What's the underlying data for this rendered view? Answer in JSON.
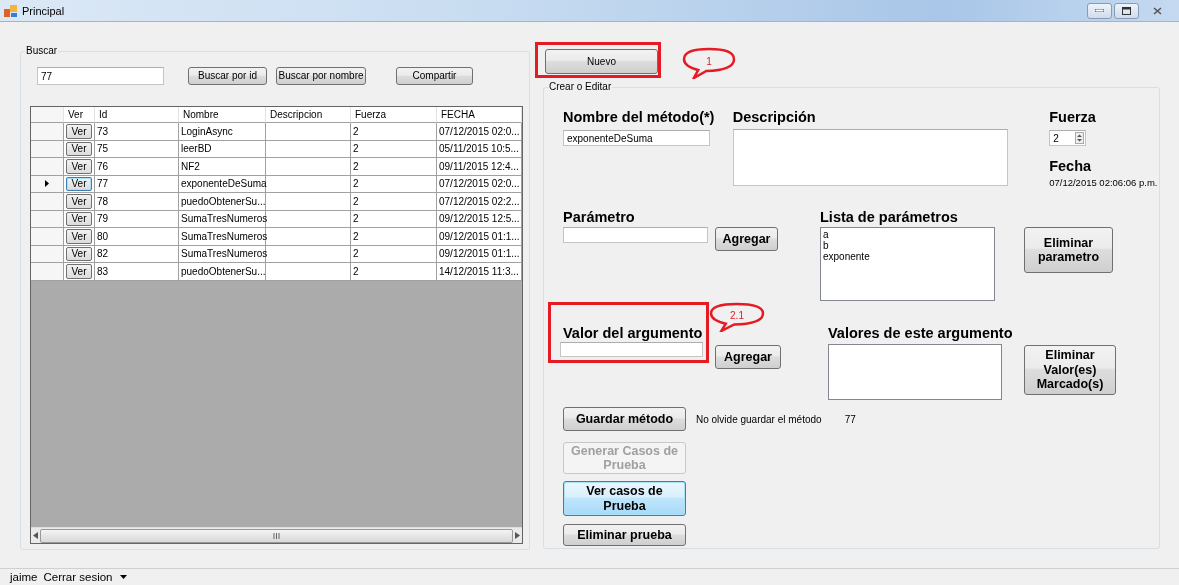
{
  "window": {
    "title": "Principal"
  },
  "search": {
    "group_title": "Buscar",
    "query": "77",
    "buttons": [
      "Buscar por id",
      "Buscar por nombre",
      "Compartir"
    ]
  },
  "table": {
    "columns": [
      "",
      "Ver",
      "Id",
      "Nombre",
      "Descripcion",
      "Fuerza",
      "FECHA"
    ],
    "rows": [
      {
        "button": "Ver",
        "id": "73",
        "nombre": "LoginAsync",
        "fuerza": "2",
        "fecha": "07/12/2015 02:0...",
        "selected": false
      },
      {
        "button": "Ver",
        "id": "75",
        "nombre": "leerBD",
        "fuerza": "2",
        "fecha": "05/11/2015 10:5...",
        "selected": false
      },
      {
        "button": "Ver",
        "id": "76",
        "nombre": "NF2",
        "fuerza": "2",
        "fecha": "09/11/2015 12:4...",
        "selected": false
      },
      {
        "button": "Ver",
        "id": "77",
        "nombre": "exponenteDeSuma",
        "fuerza": "2",
        "fecha": "07/12/2015 02:0...",
        "selected": true
      },
      {
        "button": "Ver",
        "id": "78",
        "nombre": "puedoObtenerSu...",
        "fuerza": "2",
        "fecha": "07/12/2015 02:2...",
        "selected": false
      },
      {
        "button": "Ver",
        "id": "79",
        "nombre": "SumaTresNumeros",
        "fuerza": "2",
        "fecha": "09/12/2015 12:5...",
        "selected": false
      },
      {
        "button": "Ver",
        "id": "80",
        "nombre": "SumaTresNumeros",
        "fuerza": "2",
        "fecha": "09/12/2015 01:1...",
        "selected": false
      },
      {
        "button": "Ver",
        "id": "82",
        "nombre": "SumaTresNumeros",
        "fuerza": "2",
        "fecha": "09/12/2015 01:1...",
        "selected": false
      },
      {
        "button": "Ver",
        "id": "83",
        "nombre": "puedoObtenerSu...",
        "fuerza": "2",
        "fecha": "14/12/2015 11:3...",
        "selected": false
      }
    ]
  },
  "new_button": "Nuevo",
  "editor": {
    "group_title": "Crear o Editar",
    "name_label": "Nombre del método(*)",
    "name_value": "exponenteDeSuma",
    "description_label": "Descripción",
    "strength_label": "Fuerza",
    "strength_value": "2",
    "date_label": "Fecha",
    "date_value": "07/12/2015 02:06:06 p.m.",
    "parameter_label": "Parámetro",
    "parameter_add": "Agregar",
    "parameters_label": "Lista de parámetros",
    "parameters": [
      "a",
      "b",
      "exponente"
    ],
    "remove_parameter": "Eliminar parametro",
    "argument_label": "Valor del argumento",
    "argument_add": "Agregar",
    "values_label": "Valores de este argumento",
    "remove_values": "Eliminar Valor(es) Marcado(s)",
    "save_note": "No olvide guardar el método",
    "save_id": "77",
    "actions": [
      {
        "label": "Guardar método",
        "disabled": false,
        "focused": false
      },
      {
        "label": "Generar Casos de Prueba",
        "disabled": true,
        "focused": false
      },
      {
        "label": "Ver casos de Prueba",
        "disabled": false,
        "focused": true
      },
      {
        "label": "Eliminar prueba",
        "disabled": false,
        "focused": false
      }
    ]
  },
  "annotations": [
    {
      "label": "1"
    },
    {
      "label": "2.1"
    }
  ],
  "status_bar": {
    "user": "jaime",
    "logout": "Cerrar sesion"
  }
}
